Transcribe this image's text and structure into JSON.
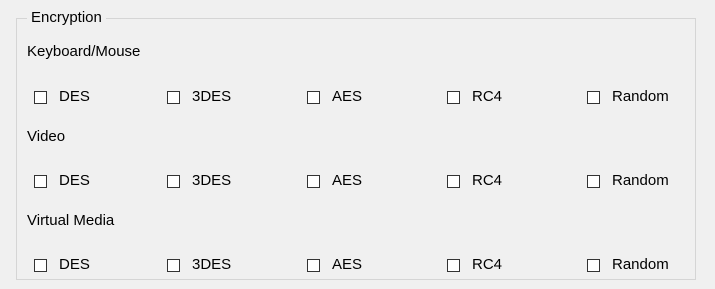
{
  "group": {
    "title": "Encryption"
  },
  "sections": [
    {
      "label": "Keyboard/Mouse",
      "options": [
        {
          "label": "DES",
          "checked": false
        },
        {
          "label": "3DES",
          "checked": false
        },
        {
          "label": "AES",
          "checked": false
        },
        {
          "label": "RC4",
          "checked": false
        },
        {
          "label": "Random",
          "checked": false
        }
      ]
    },
    {
      "label": "Video",
      "options": [
        {
          "label": "DES",
          "checked": false
        },
        {
          "label": "3DES",
          "checked": false
        },
        {
          "label": "AES",
          "checked": false
        },
        {
          "label": "RC4",
          "checked": false
        },
        {
          "label": "Random",
          "checked": false
        }
      ]
    },
    {
      "label": "Virtual Media",
      "options": [
        {
          "label": "DES",
          "checked": false
        },
        {
          "label": "3DES",
          "checked": false
        },
        {
          "label": "AES",
          "checked": false
        },
        {
          "label": "RC4",
          "checked": false
        },
        {
          "label": "Random",
          "checked": false
        }
      ]
    }
  ]
}
